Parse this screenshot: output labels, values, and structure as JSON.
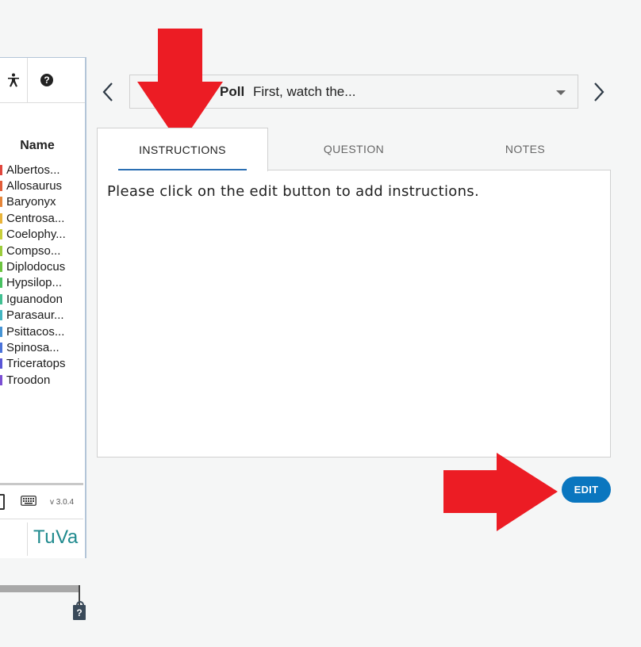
{
  "left_panel": {
    "toolbar": {
      "person_icon": "accessibility-icon",
      "help_icon": "help-icon",
      "help_glyph": "?"
    },
    "column_header": "Name",
    "cases": [
      {
        "name": "Albertos...",
        "color": "#e0463d"
      },
      {
        "name": "Allosaurus",
        "color": "#e25d39"
      },
      {
        "name": "Baryonyx",
        "color": "#e6863a"
      },
      {
        "name": "Centrosa...",
        "color": "#e9b43a"
      },
      {
        "name": "Coelophy...",
        "color": "#c8cf3a"
      },
      {
        "name": "Compso...",
        "color": "#9ccc3c"
      },
      {
        "name": "Diplodocus",
        "color": "#6cc43f"
      },
      {
        "name": "Hypsilop...",
        "color": "#48c262"
      },
      {
        "name": "Iguanodon",
        "color": "#41c092"
      },
      {
        "name": "Parasaur...",
        "color": "#43b6c2"
      },
      {
        "name": "Psittacos...",
        "color": "#4594d5"
      },
      {
        "name": "Spinosa...",
        "color": "#4b73d9"
      },
      {
        "name": "Triceratops",
        "color": "#5a56d6"
      },
      {
        "name": "Troodon",
        "color": "#7b4fd3"
      }
    ],
    "version": "v 3.0.4",
    "logo_text": "TuVa",
    "lock_help_glyph": "?"
  },
  "poll": {
    "type_label": "Poll",
    "title": "First, watch the..."
  },
  "tabs": [
    {
      "label": "INSTRUCTIONS",
      "active": true
    },
    {
      "label": "QUESTION",
      "active": false
    },
    {
      "label": "NOTES",
      "active": false
    }
  ],
  "content": {
    "instructions": "Please click on the edit button to add instructions."
  },
  "edit_button": {
    "label": "EDIT",
    "color": "#0a76bf"
  },
  "annotation_color": "#ec1c24"
}
